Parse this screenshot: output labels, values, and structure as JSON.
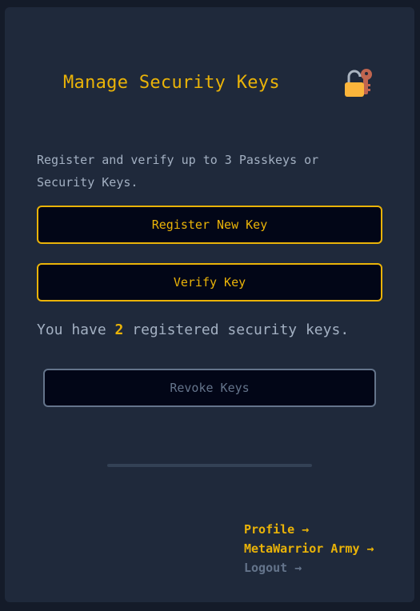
{
  "header": {
    "title": "Manage Security Keys",
    "icon": "lock-with-key-icon"
  },
  "description": "Register and verify up to 3 Passkeys or Security Keys.",
  "buttons": {
    "register": "Register New Key",
    "verify": "Verify Key",
    "revoke": "Revoke Keys"
  },
  "status": {
    "prefix": "You have ",
    "count": "2",
    "suffix": " registered security keys."
  },
  "nav": {
    "profile": "Profile →",
    "army": "MetaWarrior Army →",
    "logout": "Logout →"
  },
  "colors": {
    "background": "#141b29",
    "card": "#1f293b",
    "accent": "#eab308",
    "muted": "#64748b",
    "text": "#a3b0c2",
    "button_bg": "#020617"
  }
}
